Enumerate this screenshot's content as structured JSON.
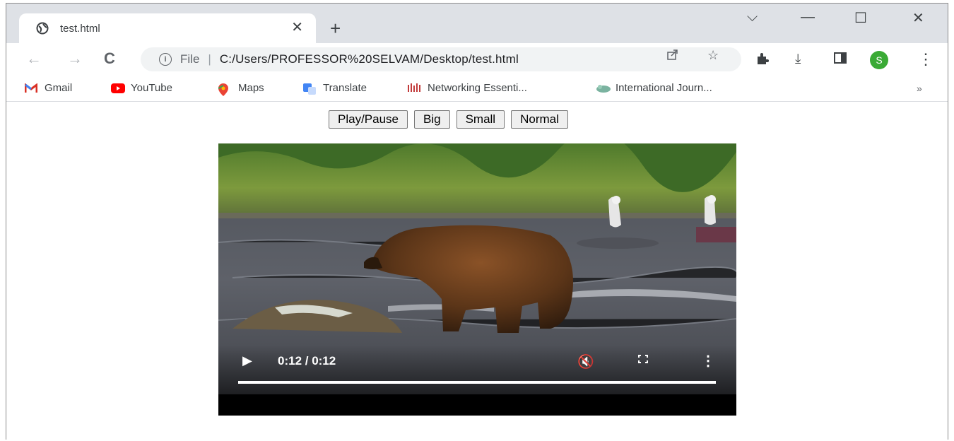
{
  "tab": {
    "title": "test.html",
    "close_glyph": "✕",
    "favicon_icon": "globe-icon"
  },
  "new_tab_glyph": "+",
  "window_controls": {
    "tab_search": "⌵",
    "minimize": "—",
    "maximize": "☐",
    "close": "✕"
  },
  "nav": {
    "back": "←",
    "forward": "→",
    "reload": "C"
  },
  "omnibox": {
    "info_glyph": "i",
    "scheme": "File",
    "separator": "|",
    "url": "C:/Users/PROFESSOR%20SELVAM/Desktop/test.html",
    "share_icon": "share-icon",
    "star_glyph": "☆"
  },
  "toolbar_icons": {
    "extensions_icon": "puzzle-icon",
    "download_glyph": "⤓",
    "sidepanel_icon": "side-panel-icon"
  },
  "profile": {
    "initial": "S",
    "color": "#3aaa35"
  },
  "menu_glyph": "⋮",
  "bookmarks": [
    {
      "label": "Gmail",
      "icon": "gmail-icon"
    },
    {
      "label": "YouTube",
      "icon": "youtube-icon"
    },
    {
      "label": "Maps",
      "icon": "maps-icon"
    },
    {
      "label": "Translate",
      "icon": "translate-icon"
    },
    {
      "label": "Networking Essenti...",
      "icon": "networking-icon"
    },
    {
      "label": "International Journ...",
      "icon": "journal-icon"
    }
  ],
  "bookmarks_more": "»",
  "page_buttons": [
    "Play/Pause",
    "Big",
    "Small",
    "Normal"
  ],
  "video": {
    "play_glyph": "▶",
    "time": "0:12 / 0:12",
    "mute_glyph": "🔇",
    "more_glyph": "⋮",
    "progress": 1.0
  }
}
